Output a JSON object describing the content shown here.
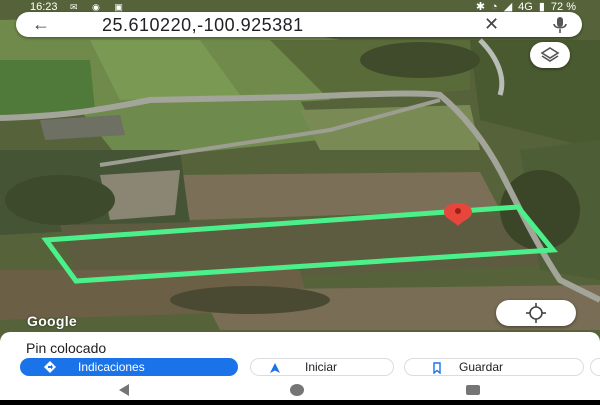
{
  "status_bar": {
    "time": "16:23",
    "battery": "72 %",
    "network": "4G"
  },
  "search": {
    "query": "25.610220,-100.925381"
  },
  "map": {
    "attribution": "Google"
  },
  "place_sheet": {
    "title": "Pin colocado",
    "actions": {
      "directions_label": "Indicaciones",
      "start_label": "Iniciar",
      "save_label": "Guardar"
    }
  },
  "colors": {
    "accent": "#1a73e8",
    "boundary": "#4cf08a",
    "pin": "#e8453c"
  },
  "icons": {
    "back": "arrow-left-icon",
    "clear": "close-icon",
    "mic": "microphone-icon",
    "layers": "layers-icon",
    "my_location": "crosshair-icon",
    "pin": "map-pin-icon"
  }
}
